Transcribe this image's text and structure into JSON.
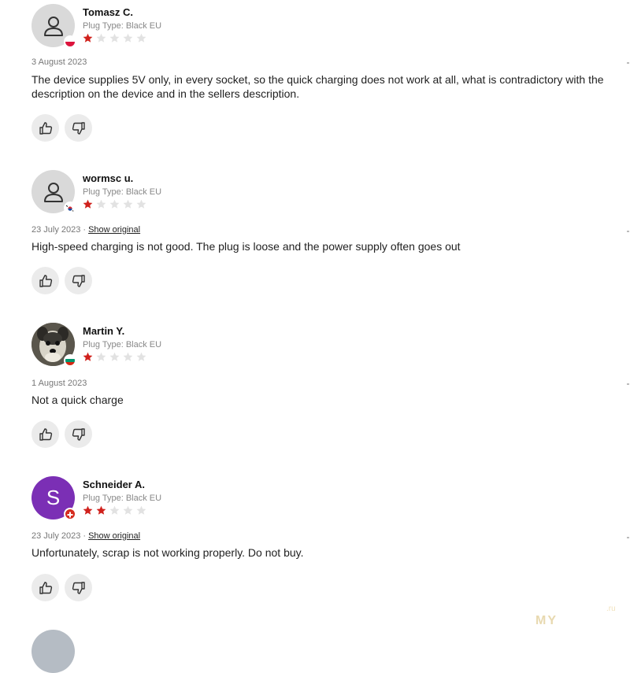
{
  "reviews": [
    {
      "name": "Tomasz C.",
      "plug": "Plug Type: Black EU",
      "rating": 1,
      "date": "3 August 2023",
      "show_original": "",
      "text": "The device supplies 5V only, in every socket, so the quick charging does not work at all, what is contradictory with the description on the device and in the sellers description.",
      "avatar": "user-icon",
      "flag": "poland-flag-icon"
    },
    {
      "name": "wormsc u.",
      "plug": "Plug Type: Black EU",
      "rating": 1,
      "date": "23 July 2023",
      "show_original": "Show original",
      "text": "High-speed charging is not good. The plug is loose and the power supply often goes out",
      "avatar": "user-icon",
      "flag": "south-korea-flag-icon"
    },
    {
      "name": "Martin Y.",
      "plug": "Plug Type: Black EU",
      "rating": 1,
      "date": "1 August 2023",
      "show_original": "",
      "text": "Not a quick charge",
      "avatar": "dog-photo",
      "flag": "bulgaria-flag-icon"
    },
    {
      "name": "Schneider A.",
      "plug": "Plug Type: Black EU",
      "rating": 2,
      "date": "23 July 2023",
      "show_original": "Show original",
      "text": "Unfortunately, scrap is not working properly. Do not buy.",
      "avatar": "S",
      "flag": "switzerland-flag-icon"
    }
  ],
  "separator": "·",
  "watermark": "MY",
  "watermark_small": ".ru",
  "colors": {
    "star_filled": "#d0211c",
    "star_empty": "#e2e2e2",
    "avatar_purple": "#7b2fb5",
    "avatar_gray": "#d9d9d9"
  }
}
